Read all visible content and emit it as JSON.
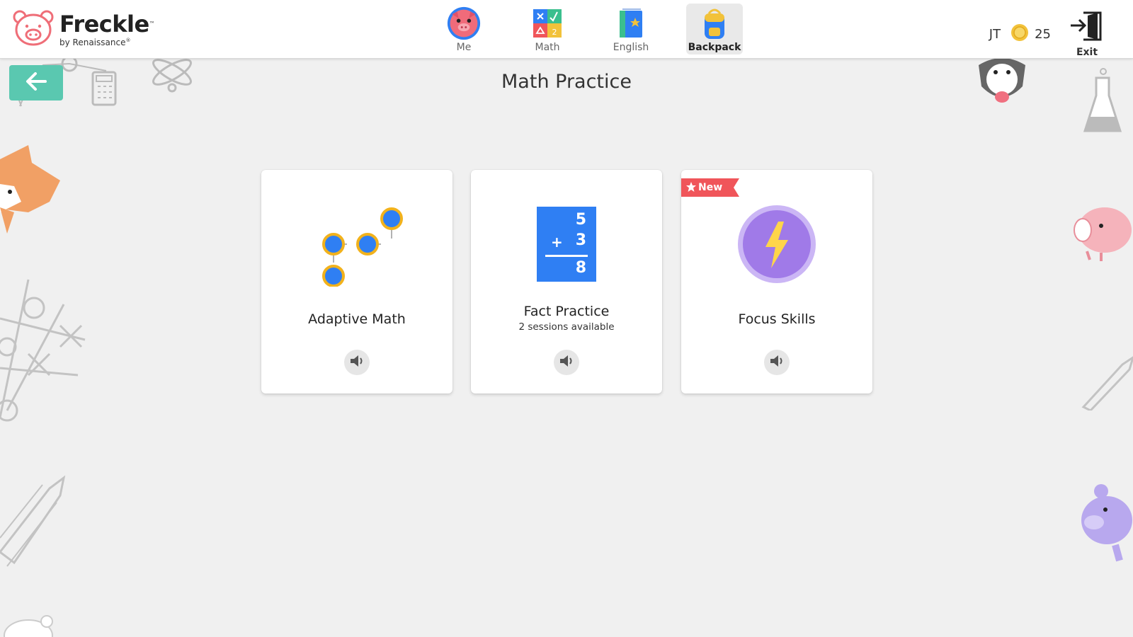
{
  "app": {
    "brand": "Freckle",
    "tm": "™",
    "byline": "by Renaissance",
    "byline_mark": "®"
  },
  "nav": [
    {
      "label": "Me",
      "icon": "pig-avatar-icon",
      "active": false
    },
    {
      "label": "Math",
      "icon": "math-symbols-icon",
      "active": false
    },
    {
      "label": "English",
      "icon": "book-icon",
      "active": false
    },
    {
      "label": "Backpack",
      "icon": "backpack-icon",
      "active": true
    }
  ],
  "user": {
    "initials": "JT",
    "coins": "25",
    "exit_label": "Exit"
  },
  "page": {
    "title": "Math Practice"
  },
  "cards": [
    {
      "title": "Adaptive Math",
      "subtitle": "",
      "icon": "connected-dots-icon"
    },
    {
      "title": "Fact Practice",
      "subtitle": "2 sessions available",
      "icon": "flash-card-icon",
      "flash_card": {
        "top": "5",
        "operator": "+",
        "second": "3",
        "result": "8"
      }
    },
    {
      "title": "Focus Skills",
      "subtitle": "",
      "icon": "lightning-bolt-icon",
      "badge": "New"
    }
  ],
  "colors": {
    "accent_teal": "#5ac8b0",
    "card_blue": "#2f7ff3",
    "dot_blue": "#2f7ff3",
    "dot_ring": "#f2b21c",
    "badge_red": "#f0555a",
    "focus_purple": "#a07ae8",
    "bolt_yellow": "#ffd54a"
  }
}
